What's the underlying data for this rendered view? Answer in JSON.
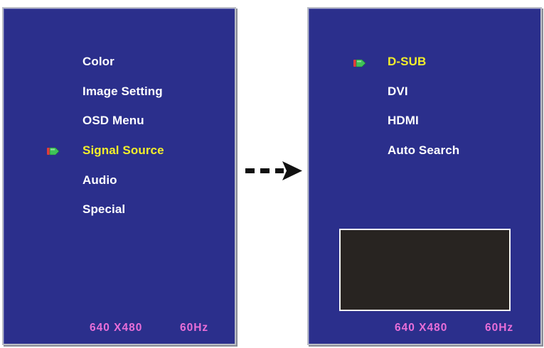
{
  "left_screen": {
    "menu_items": [
      "Color",
      "Image Setting",
      "OSD Menu",
      "Signal Source",
      "Audio",
      "Special"
    ],
    "selected_index": 3,
    "resolution": "640 X480",
    "refresh_rate": "60Hz"
  },
  "right_screen": {
    "menu_items": [
      "D-SUB",
      "DVI",
      "HDMI",
      "Auto Search"
    ],
    "selected_index": 0,
    "resolution": "640 X480",
    "refresh_rate": "60Hz"
  },
  "colors": {
    "osd_background": "#2b2f8c",
    "menu_text": "#ffffff",
    "selected_text": "#f2ee2b",
    "status_text": "#e86ed8",
    "preview_background": "#282421"
  },
  "icons": {
    "cursor": "pointer-cursor-icon",
    "transition": "dashed-arrow-right-icon"
  }
}
